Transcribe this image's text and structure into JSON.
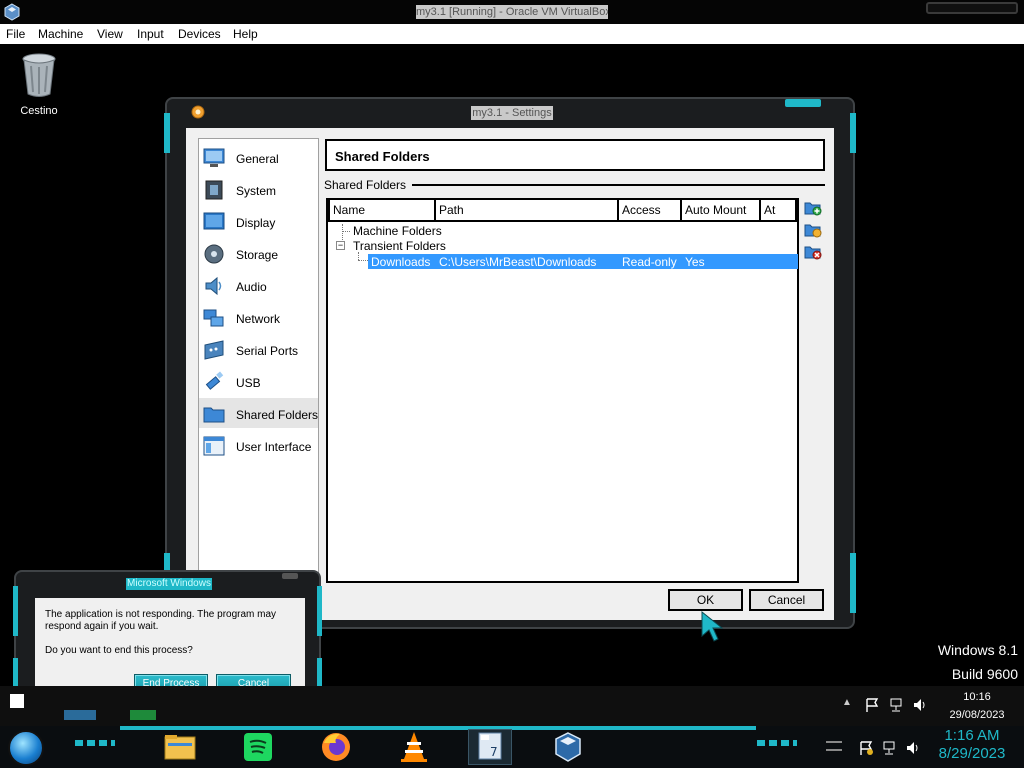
{
  "host_window": {
    "title": "my3.1 [Running] - Oracle VM VirtualBox",
    "menu": [
      "File",
      "Machine",
      "View",
      "Input",
      "Devices",
      "Help"
    ]
  },
  "desktop": {
    "icons": [
      {
        "label": "Cestino",
        "icon": "recycle-bin-icon"
      }
    ]
  },
  "settings": {
    "title": "my3.1 - Settings",
    "nav": [
      {
        "label": "General",
        "icon": "monitor-icon"
      },
      {
        "label": "System",
        "icon": "chip-icon"
      },
      {
        "label": "Display",
        "icon": "display-icon"
      },
      {
        "label": "Storage",
        "icon": "disk-icon"
      },
      {
        "label": "Audio",
        "icon": "speaker-icon"
      },
      {
        "label": "Network",
        "icon": "network-icon"
      },
      {
        "label": "Serial Ports",
        "icon": "serial-port-icon"
      },
      {
        "label": "USB",
        "icon": "usb-icon"
      },
      {
        "label": "Shared Folders",
        "icon": "folder-icon",
        "selected": true
      },
      {
        "label": "User Interface",
        "icon": "ui-icon"
      }
    ],
    "header": "Shared Folders",
    "group_label": "Shared Folders",
    "columns": [
      "Name",
      "Path",
      "Access",
      "Auto Mount",
      "At"
    ],
    "tree": {
      "machine_folders": "Machine Folders",
      "transient_folders": "Transient Folders",
      "selected_row": {
        "name": "Downloads",
        "path": "C:\\Users\\MrBeast\\Downloads",
        "access": "Read-only",
        "auto_mount": "Yes"
      }
    },
    "buttons": {
      "ok": "OK",
      "cancel": "Cancel"
    }
  },
  "dialog": {
    "title": "Microsoft Windows",
    "message_line1": "The application is not responding. The program may",
    "message_line2": "respond again if you wait.",
    "question": "Do you want to end this process?",
    "end_process": "End Process",
    "cancel": "Cancel"
  },
  "watermark": {
    "line1": "Windows 8.1",
    "line2": "Build 9600"
  },
  "tray": {
    "time": "10:16",
    "date": "29/08/2023"
  },
  "taskbar": {
    "apps": [
      "file-explorer-icon",
      "spotify-icon",
      "firefox-icon",
      "vlc-icon",
      "windows7-64-vm-icon",
      "virtualbox-icon"
    ],
    "clock_time": "1:16 AM",
    "clock_date": "8/29/2023"
  },
  "colors": {
    "accent": "#1fb8c8",
    "selection": "#3399ff"
  }
}
